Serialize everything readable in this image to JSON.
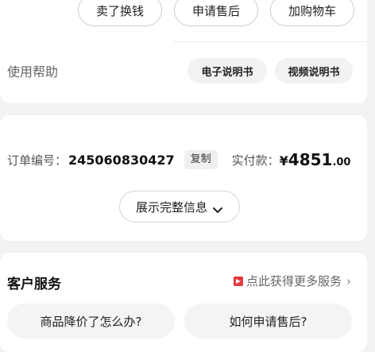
{
  "actions": {
    "sell": "卖了换钱",
    "after_sale": "申请售后",
    "add_cart": "加购物车"
  },
  "help": {
    "label": "使用帮助",
    "e_manual": "电子说明书",
    "video_manual": "视频说明书"
  },
  "order": {
    "number_label": "订单编号：",
    "number": "245060830427",
    "copy": "复制",
    "paid_label": "实付款：",
    "currency": "¥",
    "amount_int": "4851",
    "amount_dec": ".00",
    "expand": "展示完整信息"
  },
  "service": {
    "title": "客户服务",
    "more_link": "点此获得更多服务",
    "arrow": "›",
    "faq1": "商品降价了怎么办?",
    "faq2": "如何申请售后?"
  },
  "colors": {
    "background": "#f2f2f2",
    "card": "#ffffff",
    "gift_icon": "#e4393c"
  },
  "icons": {
    "chevron": "chevron-down-icon",
    "gift": "gift-icon",
    "arrow": "chevron-right-icon"
  }
}
